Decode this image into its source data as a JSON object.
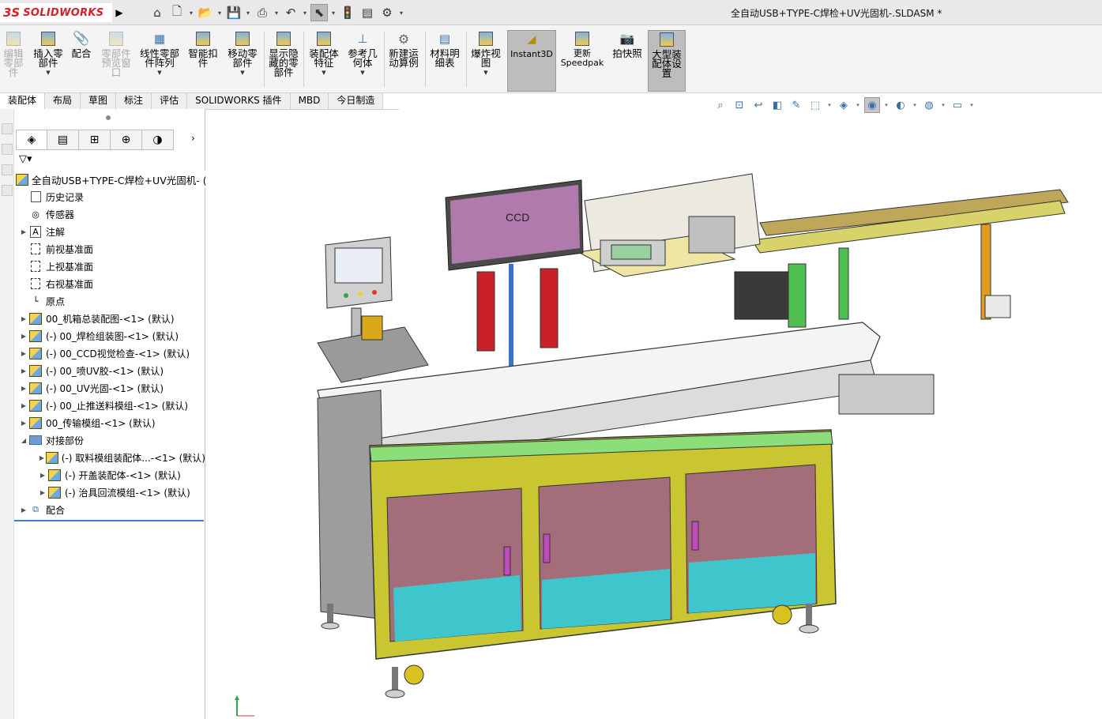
{
  "app": {
    "logo_prefix": "3S",
    "logo_name": "SOLIDWORKS",
    "document_title": "全自动USB+TYPE-C焊检+UV光固机-.SLDASM *"
  },
  "quick_access": [
    {
      "name": "home-icon",
      "glyph": "⌂"
    },
    {
      "name": "new-document-icon",
      "glyph": "🗋"
    },
    {
      "name": "open-folder-icon",
      "glyph": "📂"
    },
    {
      "name": "save-icon",
      "glyph": "💾"
    },
    {
      "name": "print-icon",
      "glyph": "⎙"
    },
    {
      "name": "undo-icon",
      "glyph": "↶"
    },
    {
      "name": "select-pointer-icon",
      "glyph": "⬉"
    },
    {
      "name": "traffic-light-icon",
      "glyph": "🚦"
    },
    {
      "name": "file-properties-icon",
      "glyph": "▤"
    },
    {
      "name": "options-gear-icon",
      "glyph": "⚙"
    }
  ],
  "ribbon": {
    "edit_component": "编辑零部件",
    "insert_component": "插入零部件",
    "mate": "配合",
    "component_preview": "零部件预览窗口",
    "linear_pattern": "线性零部件阵列",
    "smart_fasteners": "智能扣件",
    "move_component": "移动零部件",
    "show_hidden": "显示隐藏的零部件",
    "assembly_features": "装配体特征",
    "reference_geometry": "参考几何体",
    "new_motion_study": "新建运动算例",
    "bom": "材料明细表",
    "exploded_view": "爆炸视图",
    "instant3d": "Instant3D",
    "update_speedpak": "更新Speedpak",
    "snapshot": "拍快照",
    "large_assembly": "大型装配体设置"
  },
  "tabs": [
    "装配体",
    "布局",
    "草图",
    "标注",
    "评估",
    "SOLIDWORKS 插件",
    "MBD",
    "今日制造"
  ],
  "hud_icons": [
    "zoom-to-fit-icon",
    "zoom-area-icon",
    "previous-view-icon",
    "section-view-icon",
    "dynamic-annotation-icon",
    "view-orientation-icon",
    "display-style-icon",
    "hide-show-items-icon",
    "edit-appearance-icon",
    "apply-scene-icon",
    "view-settings-icon"
  ],
  "panel": {
    "tabs": [
      "featuremanager-icon",
      "propertymanager-icon",
      "configurationmanager-icon",
      "dimxpert-icon",
      "display-manager-icon"
    ],
    "tree": [
      {
        "level": 0,
        "expander": "",
        "icon": "asm",
        "label": "全自动USB+TYPE-C焊检+UV光固机-  ("
      },
      {
        "level": 1,
        "expander": "",
        "icon": "history",
        "label": "历史记录"
      },
      {
        "level": 1,
        "expander": "",
        "icon": "sensor",
        "label": "传感器"
      },
      {
        "level": 1,
        "expander": "▶",
        "icon": "annotation",
        "label": "注解"
      },
      {
        "level": 1,
        "expander": "",
        "icon": "plane",
        "label": "前视基准面"
      },
      {
        "level": 1,
        "expander": "",
        "icon": "plane",
        "label": "上视基准面"
      },
      {
        "level": 1,
        "expander": "",
        "icon": "plane",
        "label": "右视基准面"
      },
      {
        "level": 1,
        "expander": "",
        "icon": "origin",
        "label": "原点"
      },
      {
        "level": 1,
        "expander": "▶",
        "icon": "asm",
        "label": "00_机箱总装配图-<1> (默认)"
      },
      {
        "level": 1,
        "expander": "▶",
        "icon": "asm",
        "label": "(-) 00_焊检组装图-<1> (默认)"
      },
      {
        "level": 1,
        "expander": "▶",
        "icon": "asm",
        "label": "(-) 00_CCD视觉检查-<1> (默认)"
      },
      {
        "level": 1,
        "expander": "▶",
        "icon": "asm",
        "label": "(-) 00_喷UV胶-<1> (默认)"
      },
      {
        "level": 1,
        "expander": "▶",
        "icon": "asm",
        "label": "(-) 00_UV光固-<1> (默认)"
      },
      {
        "level": 1,
        "expander": "▶",
        "icon": "asm",
        "label": "(-) 00_止推送料模组-<1> (默认)"
      },
      {
        "level": 1,
        "expander": "▶",
        "icon": "asm",
        "label": "00_传输模组-<1> (默认)"
      },
      {
        "level": 1,
        "expander": "◢",
        "icon": "folder",
        "label": "对接部份"
      },
      {
        "level": 2,
        "expander": "▶",
        "icon": "asm",
        "label": "(-) 取料模组装配体...-<1> (默认)"
      },
      {
        "level": 2,
        "expander": "▶",
        "icon": "asm",
        "label": "(-) 开盖装配体-<1> (默认)"
      },
      {
        "level": 2,
        "expander": "▶",
        "icon": "asm",
        "label": "(-) 治具回流模组-<1> (默认)"
      },
      {
        "level": 1,
        "expander": "▶",
        "icon": "mates",
        "label": "配合"
      }
    ]
  },
  "model": {
    "monitor_text": "CCD"
  },
  "colors": {
    "frame_yellow": "#c9c631",
    "cabinet_pink": "#a36d7a",
    "cyan_floor": "#3fc6cc",
    "monitor_pink": "#b07aac",
    "rail_green": "#8cde7a",
    "accent_blue": "#3f83c5"
  }
}
